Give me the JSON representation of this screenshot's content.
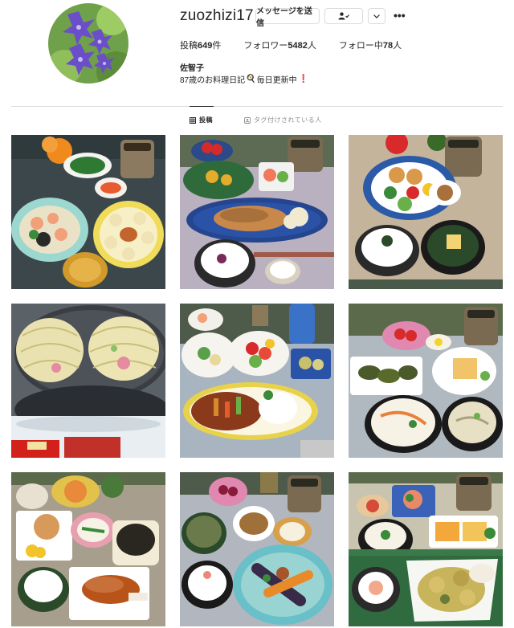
{
  "profile": {
    "username": "zuozhizi17",
    "buttons": {
      "message": "メッセージを送信",
      "follow_icon": "person-check-icon",
      "more_icon": "chevron-down-icon",
      "options_icon": "more-horizontal-icon",
      "options_text": "•••"
    },
    "stats": {
      "posts_label": "投稿",
      "posts_value": "649",
      "posts_unit": "件",
      "followers_label": "フォロワー",
      "followers_value": "5482",
      "followers_unit": "人",
      "following_label": "フォロー中",
      "following_value": "78",
      "following_unit": "人"
    },
    "full_name": "佐智子",
    "bio": {
      "text_before": "87歳のお料理日記",
      "emoji1": "🍳",
      "text_after": "毎日更新中",
      "emoji2": "❗"
    }
  },
  "tabs": [
    {
      "label": "投稿",
      "icon": "grid-icon",
      "active": true
    },
    {
      "label": "タグ付けされている人",
      "icon": "tagged-person-icon",
      "active": false
    }
  ],
  "colors": {
    "text": "#262626",
    "muted": "#8e8e8e",
    "border": "#dbdbdb",
    "accent_excl": "#e0245e"
  }
}
